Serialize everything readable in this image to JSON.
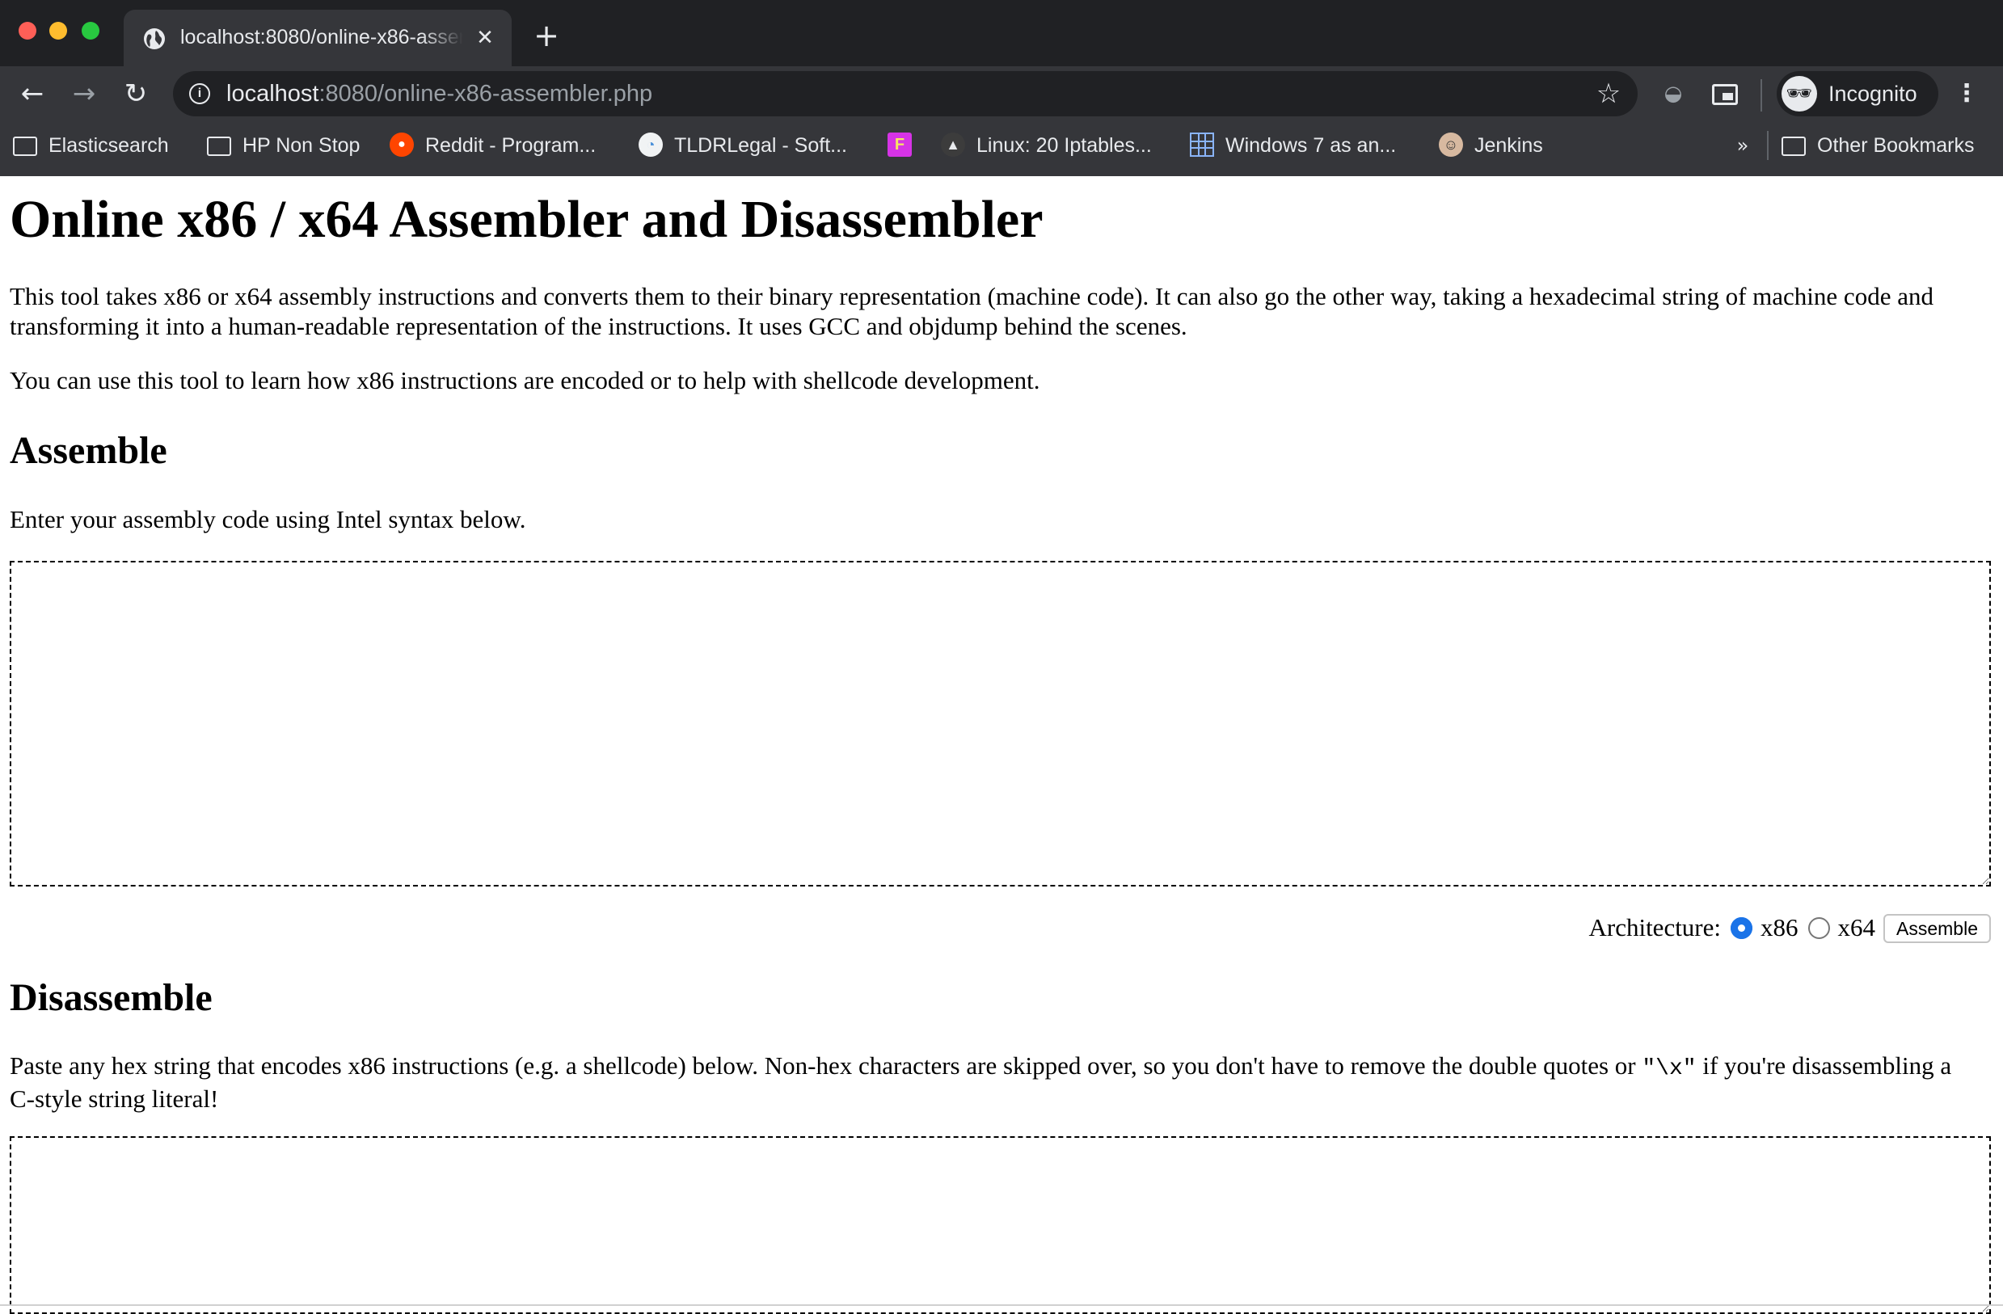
{
  "browser": {
    "tab_title": "localhost:8080/online-x86-assembler.php",
    "url_host": "localhost",
    "url_rest": ":8080/online-x86-assembler.php",
    "profile_label": "Incognito",
    "bookmarks": [
      {
        "label": "Elasticsearch",
        "icon": "folder-icon"
      },
      {
        "label": "HP Non Stop",
        "icon": "folder-icon"
      },
      {
        "label": "Reddit - Program...",
        "icon": "reddit-icon"
      },
      {
        "label": "TLDRLegal - Soft...",
        "icon": "tldrlegal-icon"
      },
      {
        "label": "",
        "icon": "feather-icon"
      },
      {
        "label": "Linux: 20 Iptables...",
        "icon": "penguin-icon"
      },
      {
        "label": "Windows 7 as an...",
        "icon": "grid-icon"
      },
      {
        "label": "Jenkins",
        "icon": "jenkins-icon"
      }
    ],
    "other_bookmarks_label": "Other Bookmarks",
    "overflow_label": "»"
  },
  "page": {
    "title": "Online x86 / x64 Assembler and Disassembler",
    "intro_1": "This tool takes x86 or x64 assembly instructions and converts them to their binary representation (machine code). It can also go the other way, taking a hexadecimal string of machine code and transforming it into a human-readable representation of the instructions. It uses GCC and objdump behind the scenes.",
    "intro_2": "You can use this tool to learn how x86 instructions are encoded or to help with shellcode development.",
    "assemble": {
      "heading": "Assemble",
      "instructions": "Enter your assembly code using Intel syntax below.",
      "input_value": "",
      "architecture_label": "Architecture:",
      "options": [
        "x86",
        "x64"
      ],
      "selected": "x86",
      "button_label": "Assemble"
    },
    "disassemble": {
      "heading": "Disassemble",
      "instructions_part1": "Paste any hex string that encodes x86 instructions (e.g. a shellcode) below. Non-hex characters are skipped over, so you don't have to remove the double quotes or ",
      "instructions_code": "\"\\x\"",
      "instructions_part2": " if you're disassembling a C-style string literal!",
      "input_value": ""
    }
  },
  "colors": {
    "tabstrip": "#202124",
    "toolbar": "#35363a",
    "radio_selected": "#1a73e8"
  }
}
